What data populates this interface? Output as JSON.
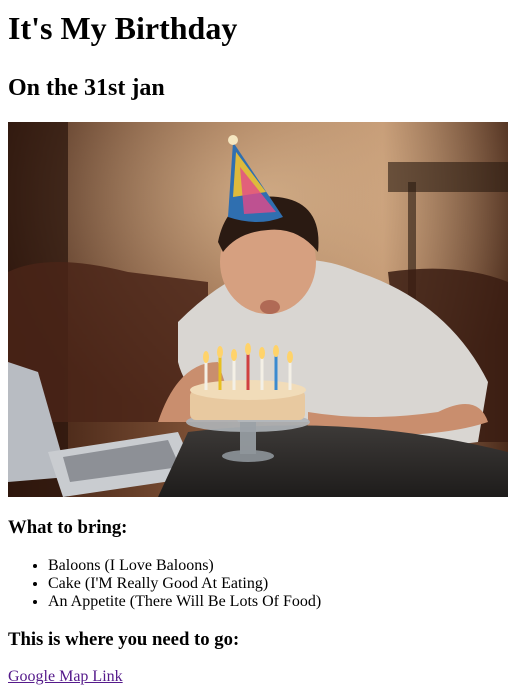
{
  "header": {
    "title": "It's My Birthday",
    "subtitle": "On the 31st jan"
  },
  "colors": {
    "visited_link": "#551a8b",
    "text": "#000000",
    "background": "#ffffff"
  },
  "bring": {
    "heading": "What to bring:",
    "items": [
      {
        "label": "Baloons (I Love Baloons)"
      },
      {
        "label": "Cake (I'M Really Good At Eating)"
      },
      {
        "label": "An Appetite (There Will Be Lots Of Food)"
      }
    ]
  },
  "location": {
    "heading": "This is where you need to go:",
    "link_text": "Google Map Link"
  }
}
